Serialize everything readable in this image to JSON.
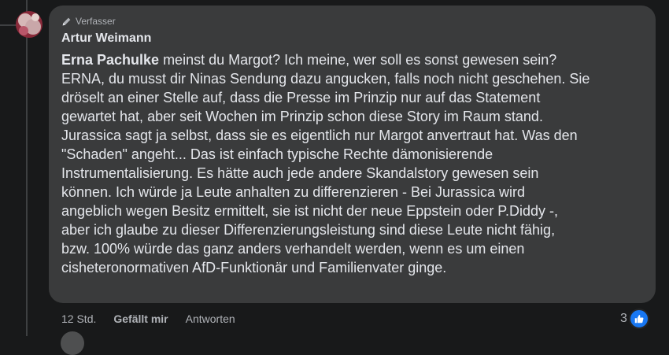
{
  "comment": {
    "badge_label": "Verfasser",
    "author": "Artur Weimann",
    "mention": "Erna Pachulke",
    "text": " meinst du Margot? Ich meine, wer soll es sonst gewesen sein?\nERNA, du musst dir Ninas Sendung dazu angucken, falls noch nicht geschehen. Sie\ndröselt an einer Stelle auf, dass die Presse im Prinzip nur auf das Statement\ngewartet hat, aber seit Wochen im Prinzip schon diese Story im Raum stand.\nJurassica sagt ja selbst, dass sie es eigentlich nur Margot anvertraut hat. Was den\n\"Schaden\" angeht... Das ist einfach typische Rechte dämonisierende\nInstrumentalisierung. Es hätte auch jede andere Skandalstory gewesen sein\nkönnen. Ich würde ja Leute anhalten zu differenzieren - Bei Jurassica wird\nangeblich wegen Besitz ermittelt, sie ist nicht der neue Eppstein oder P.Diddy -,\naber ich glaube zu dieser Differenzierungsleistung sind diese Leute nicht fähig,\nbzw. 100% würde das ganz anders verhandelt werden, wenn es um einen\ncisheteronormativen AfD-Funktionär und Familienvater ginge."
  },
  "footer": {
    "time": "12 Std.",
    "like_label": "Gefällt mir",
    "reply_label": "Antworten"
  },
  "reactions": {
    "count": "3",
    "icon": "thumbs-up-icon",
    "color": "#1877f2"
  },
  "colors": {
    "background": "#18191a",
    "bubble": "#3a3b3c",
    "text_primary": "#e4e6eb",
    "text_secondary": "#b0b3b8"
  }
}
